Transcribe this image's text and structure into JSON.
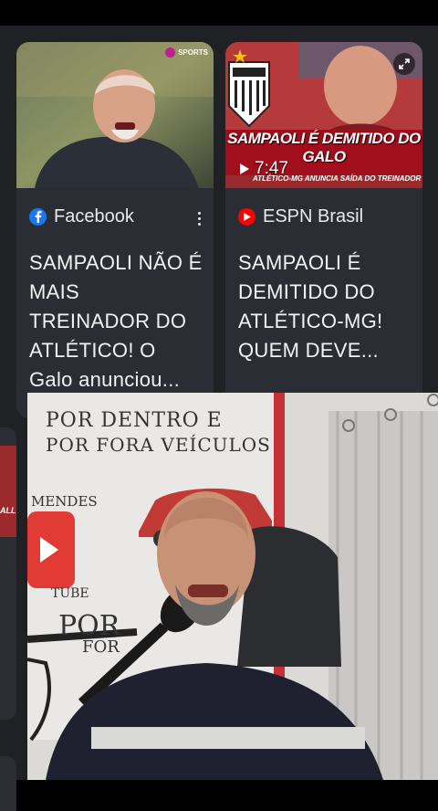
{
  "cards": [
    {
      "source_name": "Facebook",
      "source_icon": "facebook-icon",
      "headline": "SAMPAOLI NÃO É MAIS TREINADOR DO ATLÉTICO! O Galo anunciou...",
      "thumb_badge": "SPORTS"
    },
    {
      "source_name": "ESPN Brasil",
      "source_icon": "youtube-icon",
      "headline": "SAMPAOLI É DEMITIDO DO ATLÉTICO-MG! QUEM DEVE...",
      "duration": "7:47",
      "thumb_banner": "SAMPAOLI É DEMITIDO DO GALO",
      "thumb_banner_sub": "ATLÉTICO-MG ANUNCIA SAÍDA DO TREINADOR",
      "thumb_crest": "CAM"
    }
  ],
  "video_overlay": {
    "sign_line1": "POR DENTRO E",
    "sign_line2": "POR FORA VEÍCULOS",
    "side_text_1": "MENDES",
    "side_text_2": "TUBE",
    "side_text_3": "POR",
    "side_text_4": "FOR"
  },
  "edge_card_text": "ALL",
  "colors": {
    "feed_bg": "#1f2125",
    "card_bg": "#2a2d33",
    "facebook_blue": "#1877f2",
    "youtube_red": "#ff0000"
  }
}
